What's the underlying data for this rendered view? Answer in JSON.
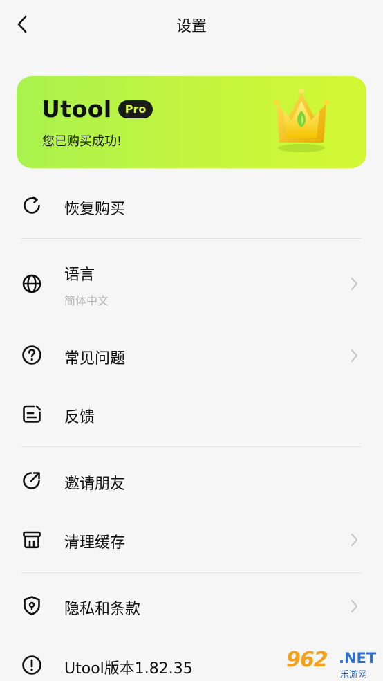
{
  "header": {
    "title": "设置",
    "back_icon": "chevron-left-icon"
  },
  "pro_card": {
    "brand": "Utool",
    "badge": "Pro",
    "message": "您已购买成功!",
    "colors": {
      "gradient_start": "#a9f24e",
      "gradient_end": "#d2f833",
      "badge_bg": "#1a1a1a"
    },
    "crown_icon": "crown-icon"
  },
  "menu": {
    "restore": {
      "label": "恢复购买",
      "icon": "refresh-icon"
    },
    "language": {
      "label": "语言",
      "value": "简体中文",
      "icon": "globe-icon"
    },
    "faq": {
      "label": "常见问题",
      "icon": "question-circle-icon"
    },
    "feedback": {
      "label": "反馈",
      "icon": "feedback-icon"
    },
    "invite": {
      "label": "邀请朋友",
      "icon": "share-icon"
    },
    "clear_cache": {
      "label": "清理缓存",
      "icon": "trash-icon"
    },
    "privacy": {
      "label": "隐私和条款",
      "icon": "shield-icon"
    },
    "version": {
      "label": "Utool版本1.82.35",
      "icon": "info-icon"
    }
  },
  "watermark": {
    "text": "962",
    "suffix": ".NET",
    "sub": "乐游网"
  }
}
